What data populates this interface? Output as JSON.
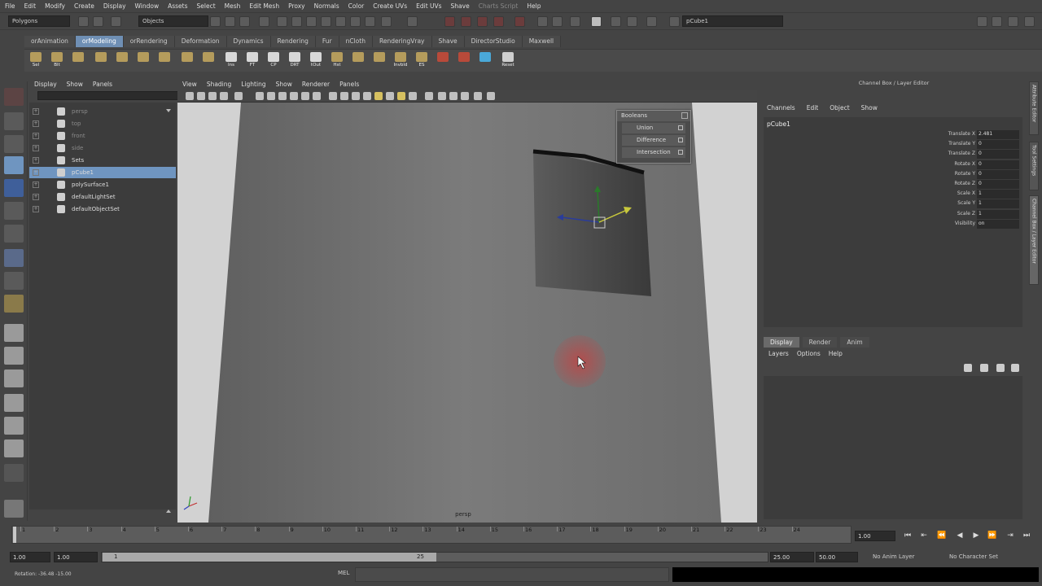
{
  "menubar": [
    "File",
    "Edit",
    "Modify",
    "Create",
    "Display",
    "Window",
    "Assets",
    "Select",
    "Mesh",
    "Edit Mesh",
    "Proxy",
    "Normals",
    "Color",
    "Create UVs",
    "Edit UVs",
    "Shave",
    "Charts Script",
    "Help"
  ],
  "statusline": {
    "mode": "Polygons",
    "selection_mode": "Objects",
    "name_field": "pCube1"
  },
  "shelf_tabs": [
    "orAnimation",
    "orModeling",
    "orRendering",
    "Deformation",
    "Dynamics",
    "Rendering",
    "Fur",
    "nCloth",
    "RenderingVray",
    "Shave",
    "DirectorStudio",
    "Maxwell"
  ],
  "active_shelf_tab": "orModeling",
  "shelf_buttons": [
    {
      "label": "Sel",
      "icon": "select-icon"
    },
    {
      "label": "Blt",
      "icon": "bolt-icon"
    },
    {
      "label": "",
      "icon": "cube-icon"
    },
    {
      "label": "",
      "icon": "sphere-icon"
    },
    {
      "label": "",
      "icon": "box-icon"
    },
    {
      "label": "",
      "icon": "cylinder-icon"
    },
    {
      "label": "",
      "icon": "extrude-icon"
    },
    {
      "label": "",
      "icon": "bevel-icon"
    },
    {
      "label": "",
      "icon": "merge-icon"
    },
    {
      "label": "Ins",
      "icon": "insert-icon"
    },
    {
      "label": "FT",
      "icon": "ft-icon"
    },
    {
      "label": "CP",
      "icon": "cp-icon"
    },
    {
      "label": "DRT",
      "icon": "drt-icon"
    },
    {
      "label": "tOut",
      "icon": "tout-icon"
    },
    {
      "label": "Hst",
      "icon": "history-icon"
    },
    {
      "label": "",
      "icon": "combine-icon"
    },
    {
      "label": "",
      "icon": "separate-icon"
    },
    {
      "label": "Invbld",
      "icon": "invbld-icon"
    },
    {
      "label": "ES",
      "icon": "es-icon"
    },
    {
      "label": "",
      "icon": "bridge-icon"
    },
    {
      "label": "",
      "icon": "paint-icon"
    },
    {
      "label": "",
      "icon": "uv-icon"
    },
    {
      "label": "Reset",
      "icon": "reset-icon"
    }
  ],
  "outliner": {
    "menu": [
      "Display",
      "Show",
      "Panels"
    ],
    "items": [
      {
        "label": "persp",
        "dim": true,
        "selected": false
      },
      {
        "label": "top",
        "dim": true,
        "selected": false
      },
      {
        "label": "front",
        "dim": true,
        "selected": false
      },
      {
        "label": "side",
        "dim": true,
        "selected": false
      },
      {
        "label": "Sets",
        "dim": false,
        "selected": false
      },
      {
        "label": "pCube1",
        "dim": false,
        "selected": true
      },
      {
        "label": "polySurface1",
        "dim": false,
        "selected": false
      },
      {
        "label": "defaultLightSet",
        "dim": false,
        "selected": false
      },
      {
        "label": "defaultObjectSet",
        "dim": false,
        "selected": false
      }
    ]
  },
  "viewport": {
    "menu": [
      "View",
      "Shading",
      "Lighting",
      "Show",
      "Renderer",
      "Panels"
    ],
    "camera_label": "persp"
  },
  "booleans": {
    "title": "Booleans",
    "items": [
      "Union",
      "Difference",
      "Intersection"
    ]
  },
  "channel_box": {
    "title": "Channel Box / Layer Editor",
    "menu": [
      "Channels",
      "Edit",
      "Object",
      "Show"
    ],
    "object": "pCube1",
    "attributes": [
      {
        "name": "Translate X",
        "value": "2.481"
      },
      {
        "name": "Translate Y",
        "value": "0"
      },
      {
        "name": "Translate Z",
        "value": "0"
      },
      {
        "name": "Rotate X",
        "value": "0"
      },
      {
        "name": "Rotate Y",
        "value": "0"
      },
      {
        "name": "Rotate Z",
        "value": "0"
      },
      {
        "name": "Scale X",
        "value": "1"
      },
      {
        "name": "Scale Y",
        "value": "1"
      },
      {
        "name": "Scale Z",
        "value": "1"
      },
      {
        "name": "Visibility",
        "value": "on"
      }
    ]
  },
  "layer_editor": {
    "tabs": [
      "Display",
      "Render",
      "Anim"
    ],
    "active_tab": "Display",
    "menu": [
      "Layers",
      "Options",
      "Help"
    ]
  },
  "side_tabs": [
    "Attribute Editor",
    "Tool Settings",
    "Channel Box / Layer Editor"
  ],
  "timeslider": {
    "ticks": [
      "1",
      "2",
      "3",
      "4",
      "5",
      "6",
      "7",
      "8",
      "9",
      "10",
      "11",
      "12",
      "13",
      "14",
      "15",
      "16",
      "17",
      "18",
      "19",
      "20",
      "21",
      "22",
      "23",
      "24"
    ],
    "current_frame": "1.00"
  },
  "range": {
    "start": "1.00",
    "anim_start": "1.00",
    "handle_start": "1",
    "handle_end": "25",
    "end": "25.00",
    "anim_end": "50.00",
    "anim_layer": "No Anim Layer",
    "character_set": "No Character Set"
  },
  "command": {
    "feedback": "Rotation: -36.48 -15.00",
    "label": "MEL"
  },
  "colors": {
    "accent": "#6f95c0",
    "background": "#444444",
    "viewport": "#d2d2d2"
  }
}
